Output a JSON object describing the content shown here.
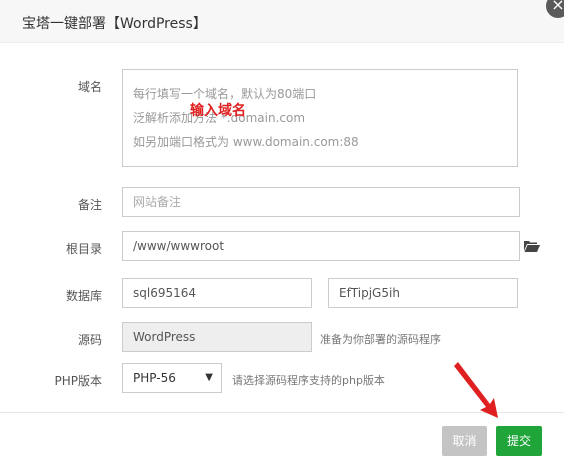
{
  "title": "宝塔一键部署【WordPress】",
  "close_glyph": "×",
  "form": {
    "domain": {
      "label": "域名",
      "hints": [
        "每行填写一个域名，默认为80端口",
        "泛解析添加方法 *.domain.com",
        "如另加端口格式为 www.domain.com:88"
      ],
      "overlay": "输入域名"
    },
    "note": {
      "label": "备注",
      "placeholder": "网站备注"
    },
    "root": {
      "label": "根目录",
      "value": "/www/wwwroot"
    },
    "database": {
      "label": "数据库",
      "user": "sql695164",
      "password": "EfTipjG5ih"
    },
    "source": {
      "label": "源码",
      "value": "WordPress",
      "hint": "准备为你部署的源码程序"
    },
    "php": {
      "label": "PHP版本",
      "selected": "PHP-56",
      "hint": "请选择源码程序支持的php版本"
    }
  },
  "buttons": {
    "cancel": "取消",
    "submit": "提交"
  },
  "colors": {
    "submit": "#20a53a",
    "cancel": "#c4c4c4",
    "annotation": "#e02020"
  }
}
